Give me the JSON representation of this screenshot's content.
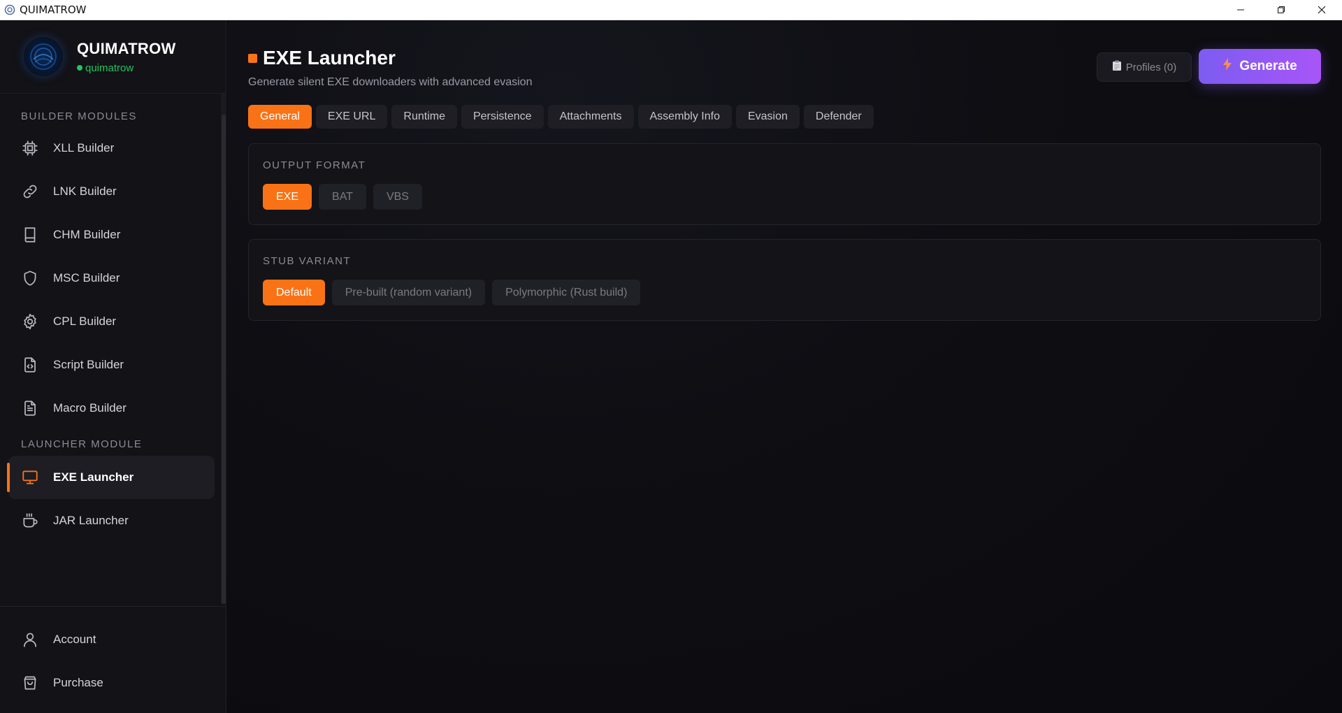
{
  "window": {
    "title": "QUIMATROW",
    "controls": [
      "minimize-icon",
      "restore-icon",
      "close-icon"
    ]
  },
  "brand": {
    "app_name": "QUIMATROW",
    "username": "quimatrow",
    "status_color": "#22c55e"
  },
  "sidebar": {
    "builder_section_label": "BUILDER MODULES",
    "builder_items": [
      {
        "label": "XLL Builder",
        "icon": "chip-icon"
      },
      {
        "label": "LNK Builder",
        "icon": "link-icon"
      },
      {
        "label": "CHM Builder",
        "icon": "book-icon"
      },
      {
        "label": "MSC Builder",
        "icon": "shield-icon"
      },
      {
        "label": "CPL Builder",
        "icon": "gear-icon"
      },
      {
        "label": "Script Builder",
        "icon": "code-file-icon"
      },
      {
        "label": "Macro Builder",
        "icon": "document-icon"
      }
    ],
    "launcher_section_label": "LAUNCHER MODULE",
    "launcher_items": [
      {
        "label": "EXE Launcher",
        "icon": "monitor-icon",
        "active": true
      },
      {
        "label": "JAR Launcher",
        "icon": "coffee-cup-icon",
        "active": false
      }
    ],
    "bottom_items": [
      {
        "label": "Account",
        "icon": "user-icon"
      },
      {
        "label": "Purchase",
        "icon": "shopping-bag-icon"
      }
    ]
  },
  "header": {
    "title": "EXE Launcher",
    "subtitle": "Generate silent EXE downloaders with advanced evasion",
    "profiles_label": "Profiles (0)",
    "generate_label": "Generate",
    "accent_color": "#f97316"
  },
  "tabs": [
    {
      "label": "General",
      "active": true
    },
    {
      "label": "EXE URL",
      "active": false
    },
    {
      "label": "Runtime",
      "active": false
    },
    {
      "label": "Persistence",
      "active": false
    },
    {
      "label": "Attachments",
      "active": false
    },
    {
      "label": "Assembly Info",
      "active": false
    },
    {
      "label": "Evasion",
      "active": false
    },
    {
      "label": "Defender",
      "active": false
    }
  ],
  "output_format": {
    "label": "OUTPUT FORMAT",
    "options": [
      {
        "label": "EXE",
        "active": true
      },
      {
        "label": "BAT",
        "active": false
      },
      {
        "label": "VBS",
        "active": false
      }
    ]
  },
  "stub_variant": {
    "label": "STUB VARIANT",
    "options": [
      {
        "label": "Default",
        "active": true
      },
      {
        "label": "Pre-built (random variant)",
        "active": false
      },
      {
        "label": "Polymorphic (Rust build)",
        "active": false
      }
    ]
  }
}
